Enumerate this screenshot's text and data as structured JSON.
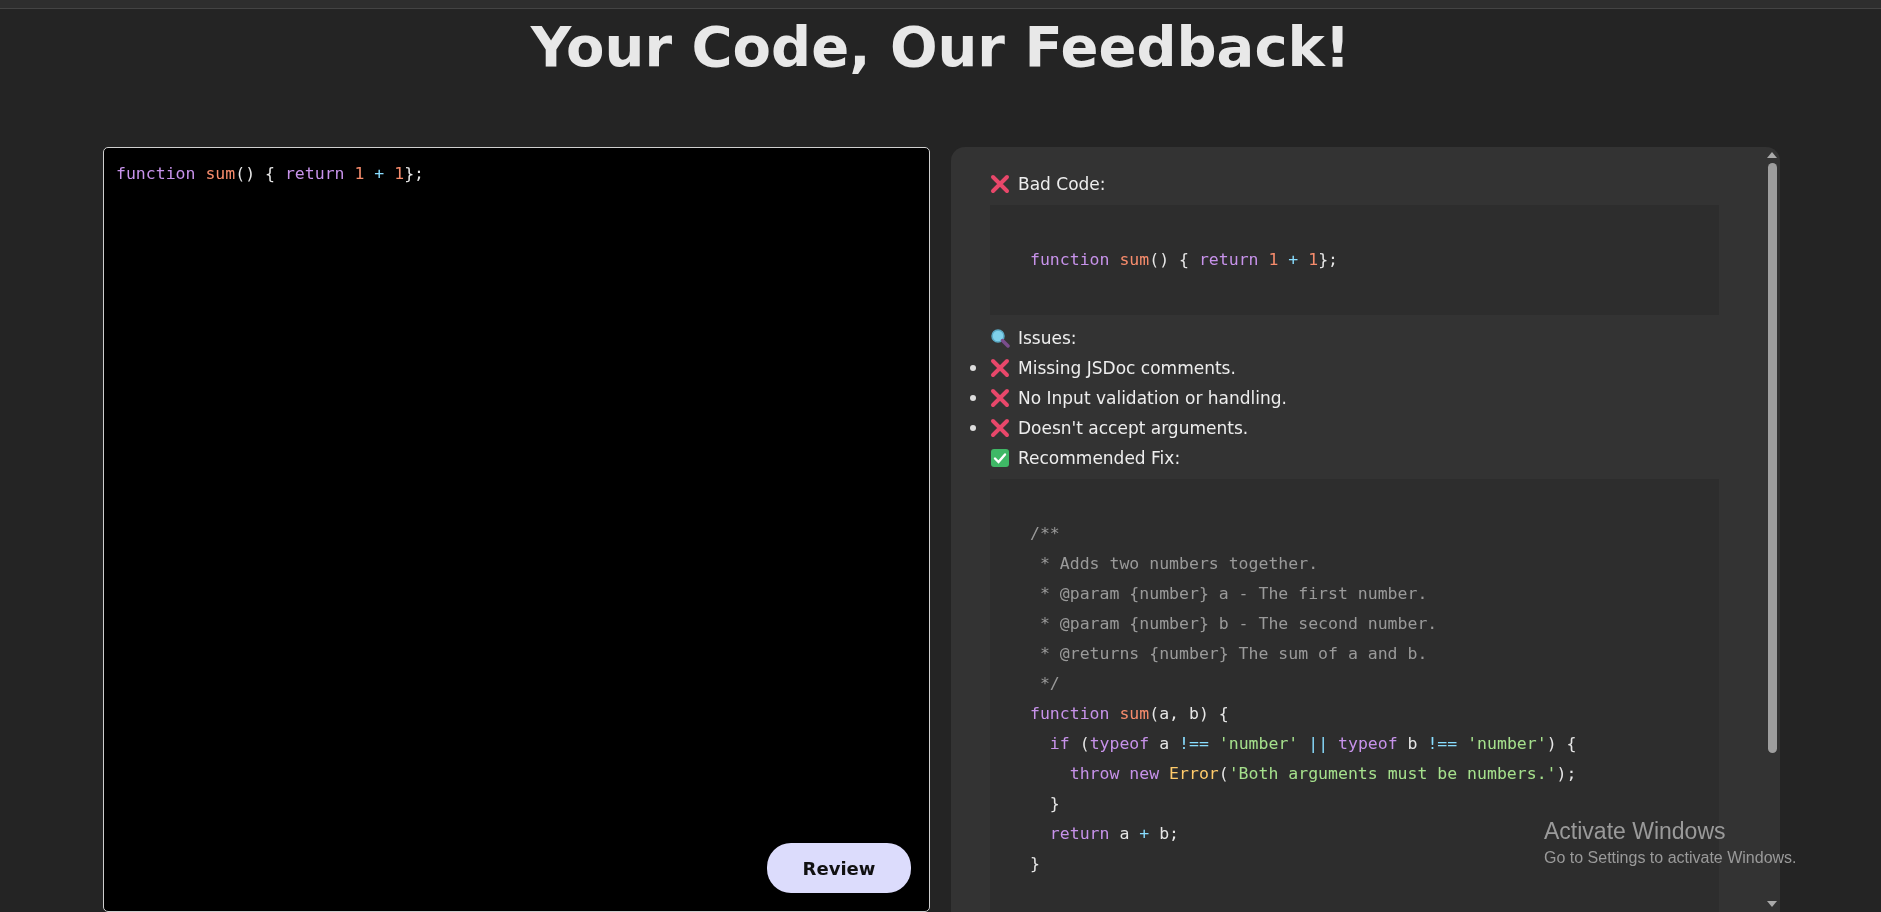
{
  "title": "Your Code, Our Feedback!",
  "editor": {
    "lines": [
      [
        {
          "text": "function ",
          "kind": "keyword"
        },
        {
          "text": "sum",
          "kind": "function"
        },
        {
          "text": "() { ",
          "kind": "plain"
        },
        {
          "text": "return ",
          "kind": "keyword"
        },
        {
          "text": "1 ",
          "kind": "number"
        },
        {
          "text": "+ ",
          "kind": "operator"
        },
        {
          "text": "1",
          "kind": "number"
        },
        {
          "text": "};",
          "kind": "plain"
        }
      ]
    ],
    "button": "Review"
  },
  "feedback": [
    {
      "kind": "error_heading",
      "text": "Bad Code:"
    },
    {
      "kind": "code",
      "lines": [
        [
          {
            "text": "function ",
            "kind": "keyword"
          },
          {
            "text": "sum",
            "kind": "function"
          },
          {
            "text": "() { ",
            "kind": "plain"
          },
          {
            "text": "return ",
            "kind": "keyword"
          },
          {
            "text": "1 ",
            "kind": "number"
          },
          {
            "text": "+ ",
            "kind": "operator"
          },
          {
            "text": "1",
            "kind": "number"
          },
          {
            "text": "};",
            "kind": "plain"
          }
        ]
      ]
    },
    {
      "kind": "search_heading",
      "text": "Issues:"
    },
    {
      "kind": "issue",
      "text": "Missing JSDoc comments."
    },
    {
      "kind": "issue",
      "text": "No Input validation or handling."
    },
    {
      "kind": "issue",
      "text": "Doesn't accept arguments."
    },
    {
      "kind": "success_heading",
      "text": "Recommended Fix:"
    },
    {
      "kind": "code",
      "lines": [
        [
          {
            "text": "/**",
            "kind": "comment"
          }
        ],
        [
          {
            "text": " * Adds two numbers together.",
            "kind": "comment"
          }
        ],
        [
          {
            "text": " * @param {number} a - The first number.",
            "kind": "comment"
          }
        ],
        [
          {
            "text": " * @param {number} b - The second number.",
            "kind": "comment"
          }
        ],
        [
          {
            "text": " * @returns {number} The sum of a and b.",
            "kind": "comment"
          }
        ],
        [
          {
            "text": " */",
            "kind": "comment"
          }
        ],
        [
          {
            "text": "function ",
            "kind": "keyword"
          },
          {
            "text": "sum",
            "kind": "function"
          },
          {
            "text": "(a, b) {",
            "kind": "plain"
          }
        ],
        [
          {
            "text": "  if",
            "kind": "keyword"
          },
          {
            "text": " (",
            "kind": "plain"
          },
          {
            "text": "typeof",
            "kind": "keyword"
          },
          {
            "text": " a ",
            "kind": "plain"
          },
          {
            "text": "!== ",
            "kind": "operator"
          },
          {
            "text": "'number' ",
            "kind": "string"
          },
          {
            "text": "|| ",
            "kind": "operator"
          },
          {
            "text": "typeof",
            "kind": "keyword"
          },
          {
            "text": " b ",
            "kind": "plain"
          },
          {
            "text": "!== ",
            "kind": "operator"
          },
          {
            "text": "'number'",
            "kind": "string"
          },
          {
            "text": ") {",
            "kind": "plain"
          }
        ],
        [
          {
            "text": "    throw new ",
            "kind": "keyword"
          },
          {
            "text": "Error",
            "kind": "class"
          },
          {
            "text": "(",
            "kind": "plain"
          },
          {
            "text": "'Both arguments must be numbers.'",
            "kind": "string"
          },
          {
            "text": ");",
            "kind": "plain"
          }
        ],
        [
          {
            "text": "  }",
            "kind": "plain"
          }
        ],
        [
          {
            "text": "  return",
            "kind": "keyword"
          },
          {
            "text": " a ",
            "kind": "plain"
          },
          {
            "text": "+",
            "kind": "operator"
          },
          {
            "text": " b;",
            "kind": "plain"
          }
        ],
        [
          {
            "text": "}",
            "kind": "plain"
          }
        ]
      ]
    }
  ],
  "os_notice": {
    "title": "Activate Windows",
    "subtitle": "Go to Settings to activate Windows."
  }
}
